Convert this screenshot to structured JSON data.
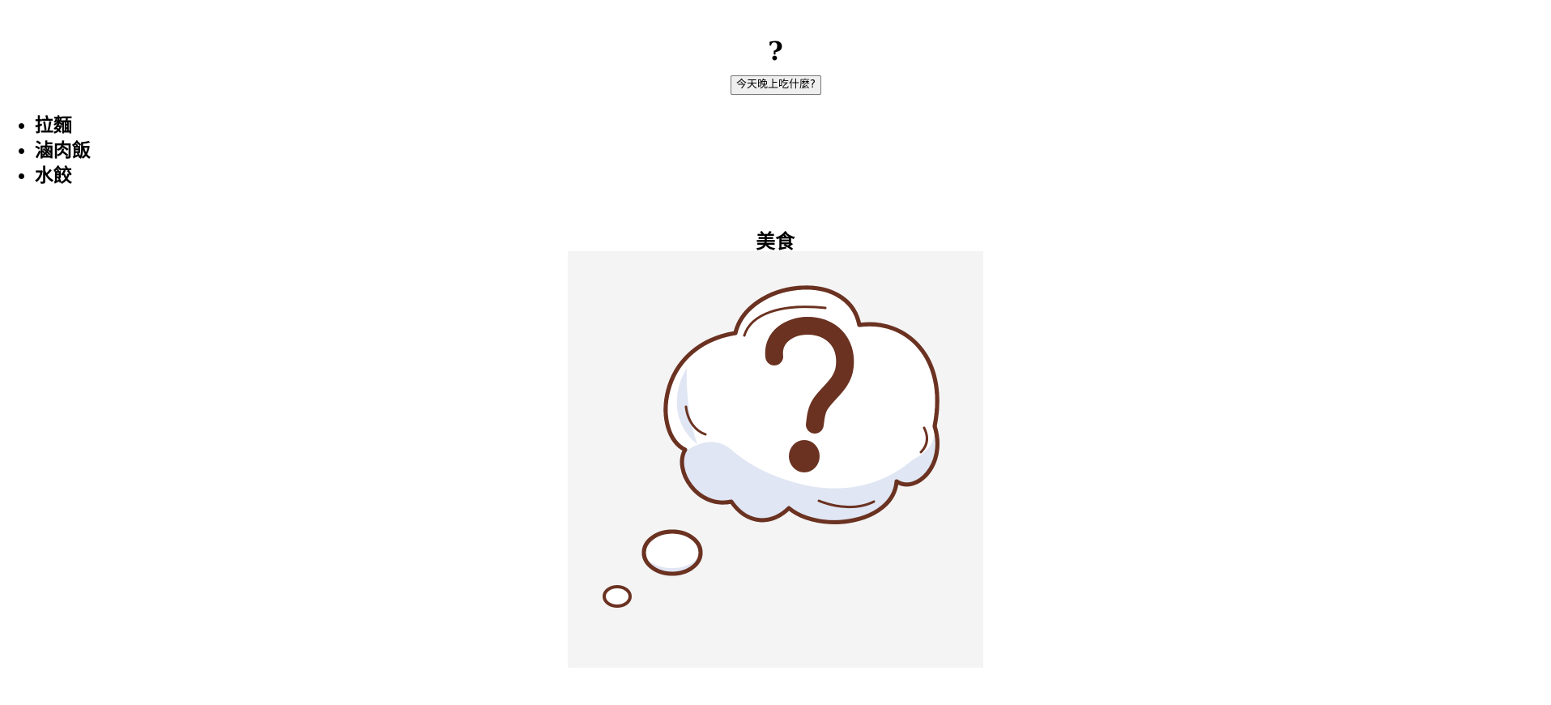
{
  "page": {
    "title": "?"
  },
  "action": {
    "button_label": "今天晚上吃什麼?"
  },
  "foods": [
    {
      "label": "拉麵"
    },
    {
      "label": "滷肉飯"
    },
    {
      "label": "水餃"
    }
  ],
  "section": {
    "title": "美食"
  },
  "image": {
    "icon": "thought-bubble-question-icon",
    "colors": {
      "background": "#f4f4f4",
      "outline": "#6b3221",
      "fill": "#ffffff",
      "shade": "#e0e6f3"
    }
  }
}
